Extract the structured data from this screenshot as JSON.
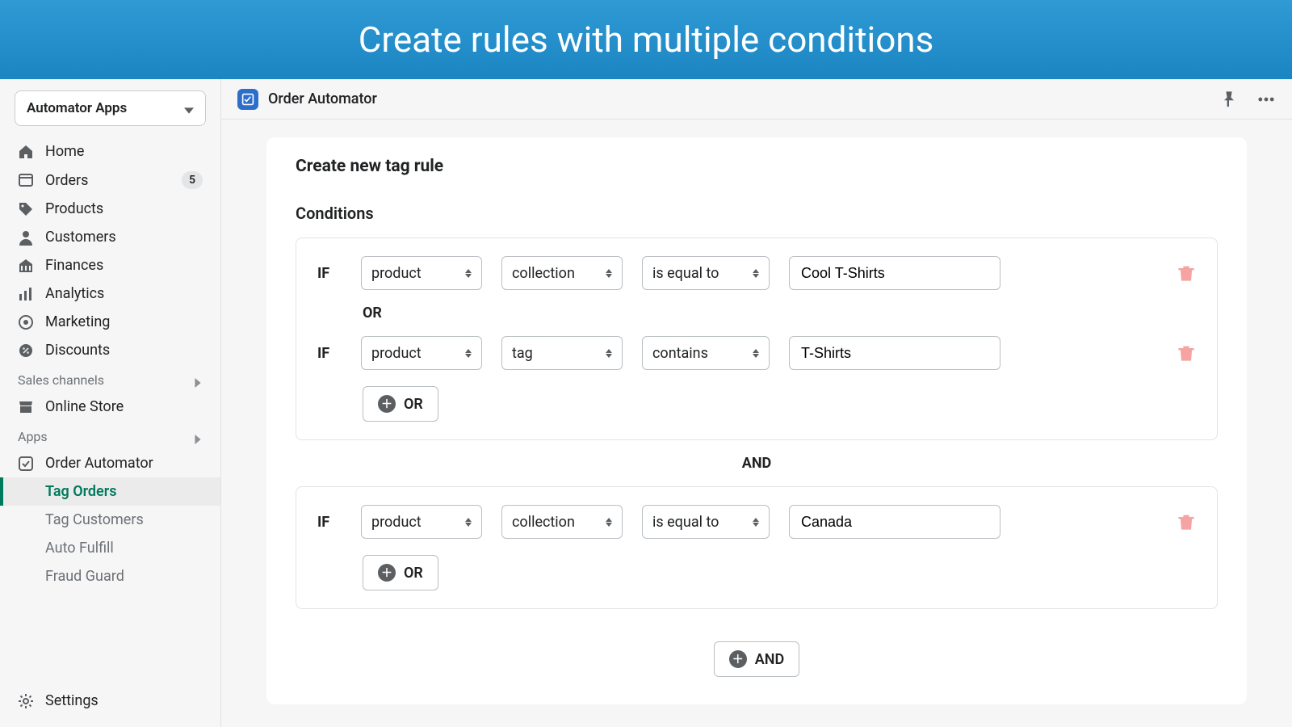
{
  "banner": {
    "title": "Create rules with multiple conditions"
  },
  "sidebar": {
    "store_switcher": "Automator Apps",
    "nav": [
      {
        "icon": "home-icon",
        "label": "Home"
      },
      {
        "icon": "orders-icon",
        "label": "Orders",
        "badge": "5"
      },
      {
        "icon": "products-icon",
        "label": "Products"
      },
      {
        "icon": "customers-icon",
        "label": "Customers"
      },
      {
        "icon": "finances-icon",
        "label": "Finances"
      },
      {
        "icon": "analytics-icon",
        "label": "Analytics"
      },
      {
        "icon": "marketing-icon",
        "label": "Marketing"
      },
      {
        "icon": "discounts-icon",
        "label": "Discounts"
      }
    ],
    "channels_hdr": "Sales channels",
    "channels": [
      {
        "icon": "store-icon",
        "label": "Online Store"
      }
    ],
    "apps_hdr": "Apps",
    "apps": [
      {
        "icon": "automator-icon",
        "label": "Order Automator",
        "sub": [
          {
            "label": "Tag Orders",
            "selected": true
          },
          {
            "label": "Tag Customers"
          },
          {
            "label": "Auto Fulfill"
          },
          {
            "label": "Fraud Guard"
          }
        ]
      }
    ],
    "settings": "Settings"
  },
  "topbar": {
    "app_name": "Order Automator"
  },
  "main": {
    "heading": "Create new tag rule",
    "conditions_label": "Conditions",
    "groups": [
      {
        "rows": [
          {
            "if": "IF",
            "s1": "product",
            "s2": "collection",
            "s3": "is equal to",
            "val": "Cool T-Shirts"
          },
          {
            "sep": "OR"
          },
          {
            "if": "IF",
            "s1": "product",
            "s2": "tag",
            "s3": "contains",
            "val": "T-Shirts"
          }
        ],
        "add_or": "OR"
      },
      {
        "and": "AND"
      },
      {
        "rows": [
          {
            "if": "IF",
            "s1": "product",
            "s2": "collection",
            "s3": "is equal to",
            "val": "Canada"
          }
        ],
        "add_or": "OR"
      }
    ],
    "add_and": "AND"
  }
}
